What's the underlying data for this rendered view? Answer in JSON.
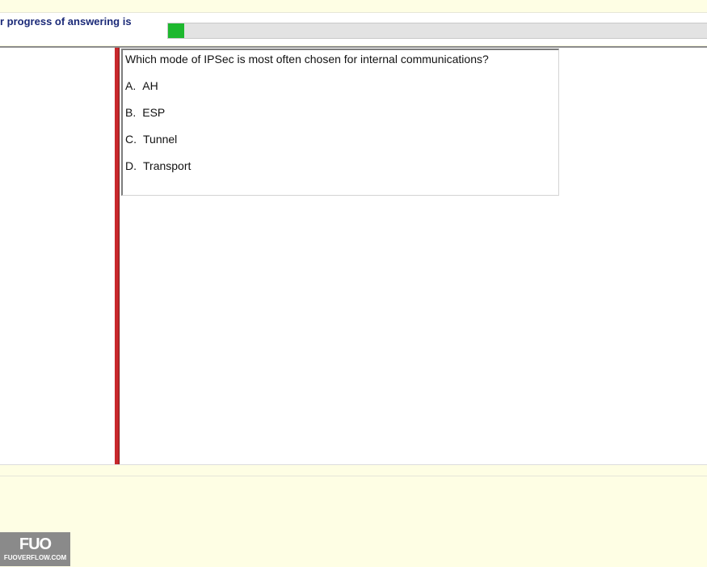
{
  "progress": {
    "label": "r progress of answering is",
    "value_fraction": 0.03,
    "fill_color": "#1db82e"
  },
  "question": {
    "text": "Which mode of IPSec is most often chosen for internal communications?",
    "options": [
      {
        "letter": "A.",
        "text": "AH"
      },
      {
        "letter": "B.",
        "text": "ESP"
      },
      {
        "letter": "C.",
        "text": "Tunnel"
      },
      {
        "letter": "D.",
        "text": "Transport"
      }
    ]
  },
  "watermark": {
    "logo": "FUO",
    "site": "FUOVERFLOW.COM"
  },
  "colors": {
    "background": "#fefee4",
    "accent_bar": "#c7282c",
    "label_text": "#1b2a78"
  }
}
